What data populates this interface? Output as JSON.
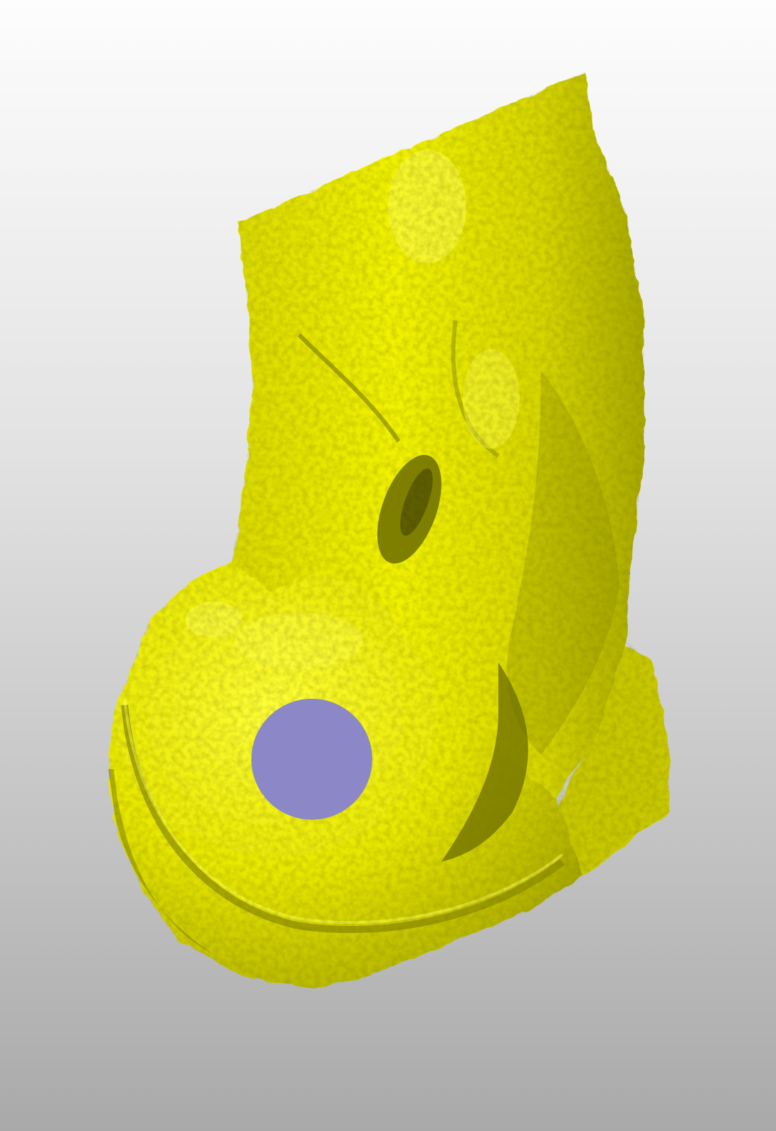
{
  "scene": {
    "background_top": "#fdfdfd",
    "background_bottom": "#a9a9a9",
    "model": {
      "name": "bone-mesh",
      "color": "#e6e600",
      "highlight_color": "#ffff33",
      "shadow_color": "#6b6b00"
    },
    "marker": {
      "shape": "circle",
      "color": "#8c88c8"
    }
  }
}
